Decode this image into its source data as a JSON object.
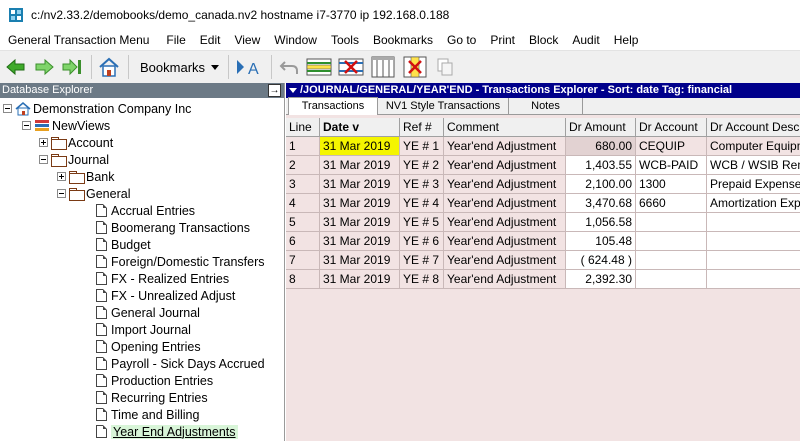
{
  "titlebar": {
    "title": "c:/nv2.33.2/demobooks/demo_canada.nv2 hostname i7-3770 ip 192.168.0.188"
  },
  "menubar": {
    "items": [
      "General Transaction Menu",
      "File",
      "Edit",
      "View",
      "Window",
      "Tools",
      "Bookmarks",
      "Go to",
      "Print",
      "Block",
      "Audit",
      "Help"
    ]
  },
  "toolbar": {
    "bookmarks_label": "Bookmarks",
    "icons": [
      "back-arrow-icon",
      "forward-arrow-icon",
      "forward-end-icon",
      "home-icon",
      "pointer-a-icon",
      "undo-icon",
      "insert-row-icon",
      "delete-row-icon",
      "columns-icon",
      "delete-column-icon",
      "copy-icon"
    ]
  },
  "explorer": {
    "title": "Database Explorer",
    "pin": "→",
    "nodes": {
      "company": "Demonstration Company Inc",
      "newviews": "NewViews",
      "account": "Account",
      "journal": "Journal",
      "bank": "Bank",
      "general": "General",
      "accrual": "Accrual Entries",
      "boomerang": "Boomerang Transactions",
      "budget": "Budget",
      "foreign": "Foreign/Domestic Transfers",
      "fxrealized": "FX - Realized Entries",
      "fxunrealized": "FX - Unrealized Adjust",
      "generaljournal": "General Journal",
      "importjournal": "Import Journal",
      "opening": "Opening Entries",
      "payroll": "Payroll - Sick Days Accrued",
      "production": "Production Entries",
      "recurring": "Recurring Entries",
      "timebilling": "Time and Billing",
      "yearend": "Year End Adjustments"
    }
  },
  "transactions": {
    "header": "/JOURNAL/GENERAL/YEAR'END - Transactions Explorer - Sort: date   Tag: financial",
    "tabs": [
      "Transactions",
      "NV1 Style Transactions",
      "Notes"
    ],
    "columns": [
      "Line",
      "Date v",
      "Ref #",
      "Comment",
      "Dr Amount",
      "Dr Account",
      "Dr Account Desc"
    ],
    "rows": [
      {
        "line": "1",
        "date": "31 Mar 2019",
        "ref": "YE # 1",
        "comment": "Year'end Adjustment",
        "amount": "680.00",
        "account": "CEQUIP",
        "desc": "Computer Equipment"
      },
      {
        "line": "2",
        "date": "31 Mar 2019",
        "ref": "YE # 2",
        "comment": "Year'end Adjustment",
        "amount": "1,403.55",
        "account": "WCB-PAID",
        "desc": "WCB / WSIB Remittance"
      },
      {
        "line": "3",
        "date": "31 Mar 2019",
        "ref": "YE # 3",
        "comment": "Year'end Adjustment",
        "amount": "2,100.00",
        "account": "1300",
        "desc": "Prepaid Expenses"
      },
      {
        "line": "4",
        "date": "31 Mar 2019",
        "ref": "YE # 4",
        "comment": "Year'end Adjustment",
        "amount": "3,470.68",
        "account": "6660",
        "desc": "Amortization Expense"
      },
      {
        "line": "5",
        "date": "31 Mar 2019",
        "ref": "YE # 5",
        "comment": "Year'end Adjustment",
        "amount": "1,056.58",
        "account": "",
        "desc": ""
      },
      {
        "line": "6",
        "date": "31 Mar 2019",
        "ref": "YE # 6",
        "comment": "Year'end Adjustment",
        "amount": "105.48",
        "account": "",
        "desc": ""
      },
      {
        "line": "7",
        "date": "31 Mar 2019",
        "ref": "YE # 7",
        "comment": "Year'end Adjustment",
        "amount": "( 624.48 )",
        "account": "",
        "desc": ""
      },
      {
        "line": "8",
        "date": "31 Mar 2019",
        "ref": "YE # 8",
        "comment": "Year'end Adjustment",
        "amount": "2,392.30",
        "account": "",
        "desc": ""
      }
    ]
  },
  "colors": {
    "header_blue": "#00008b",
    "explorer_header": "#6c7a86",
    "grid_background": "#f2e3e3",
    "highlight_date": "#f5f500",
    "selected_node": "#d8f5d8"
  }
}
